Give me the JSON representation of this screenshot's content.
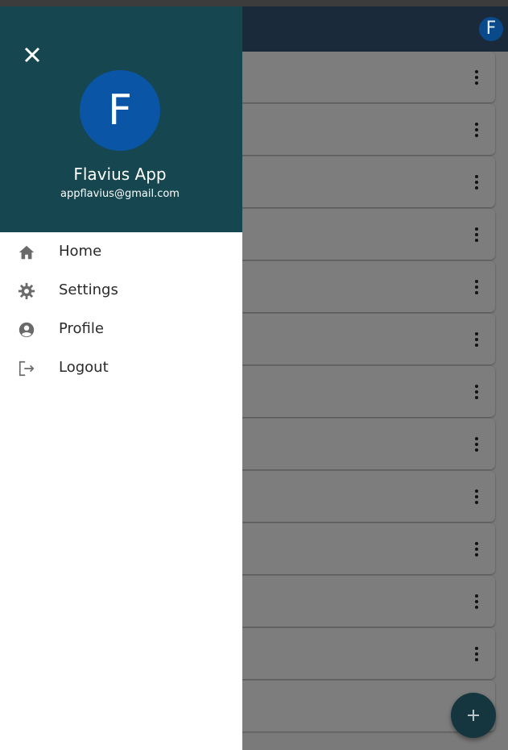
{
  "app_bar": {
    "avatar_letter": "F"
  },
  "drawer": {
    "close_icon": "close-icon",
    "avatar_letter": "F",
    "name": "Flavius App",
    "email": "appflavius@gmail.com",
    "header_color": "#164650",
    "avatar_color": "#0a55a6",
    "menu": [
      {
        "label": "Home",
        "icon": "home-icon"
      },
      {
        "label": "Settings",
        "icon": "gear-icon"
      },
      {
        "label": "Profile",
        "icon": "account-circle-icon"
      },
      {
        "label": "Logout",
        "icon": "logout-icon"
      }
    ]
  },
  "list": {
    "item_count": 13,
    "more_icon": "more-vertical-icon"
  },
  "fab": {
    "icon": "plus-icon",
    "color": "#15353f"
  }
}
